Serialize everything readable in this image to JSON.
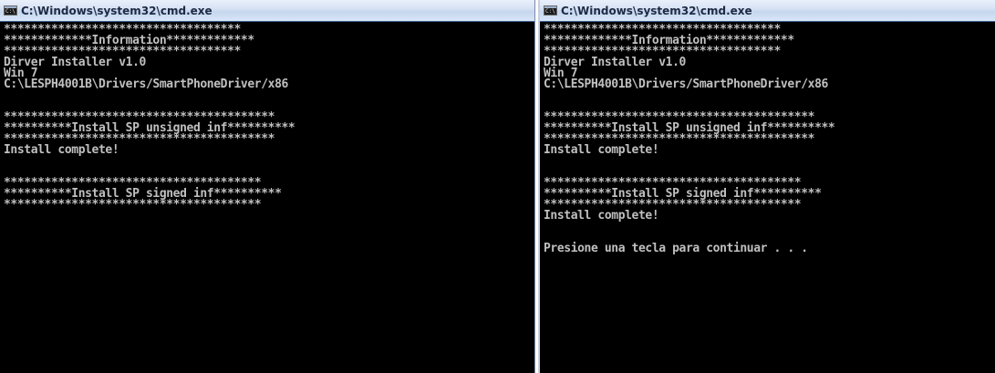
{
  "windows": [
    {
      "title": "C:\\Windows\\system32\\cmd.exe",
      "icon": "cmd-icon",
      "lines": [
        "***********************************",
        "*************Information*************",
        "***********************************",
        "Dirver Installer v1.0",
        "Win 7",
        "C:\\LESPH4001B\\Drivers/SmartPhoneDriver/x86",
        "",
        "",
        "****************************************",
        "**********Install SP unsigned inf**********",
        "****************************************",
        "Install complete!",
        "",
        "",
        "**************************************",
        "**********Install SP signed inf**********",
        "**************************************"
      ]
    },
    {
      "title": "C:\\Windows\\system32\\cmd.exe",
      "icon": "cmd-icon",
      "lines": [
        "***********************************",
        "*************Information*************",
        "***********************************",
        "Dirver Installer v1.0",
        "Win 7",
        "C:\\LESPH4001B\\Drivers/SmartPhoneDriver/x86",
        "",
        "",
        "****************************************",
        "**********Install SP unsigned inf**********",
        "****************************************",
        "Install complete!",
        "",
        "",
        "**************************************",
        "**********Install SP signed inf**********",
        "**************************************",
        "Install complete!",
        "",
        "",
        "Presione una tecla para continuar . . ."
      ]
    }
  ]
}
